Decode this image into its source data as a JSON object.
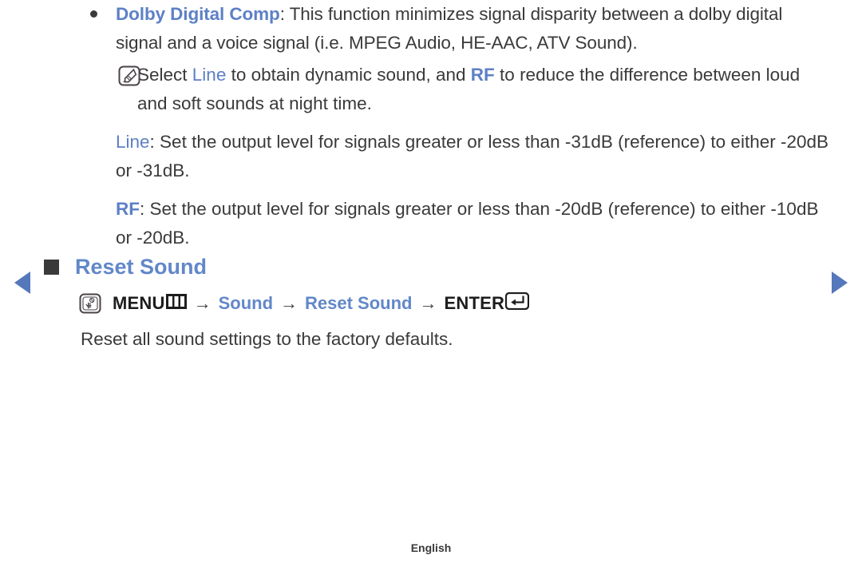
{
  "nav": {
    "prev_icon": "triangle-left-icon",
    "next_icon": "triangle-right-icon",
    "accent_color": "#5577bb"
  },
  "bullet": {
    "term": "Dolby Digital Comp",
    "text_part1": ": This function minimizes signal disparity between a dolby digital signal and a voice signal (i.e. MPEG Audio, HE-AAC, ATV Sound)."
  },
  "note": {
    "icon": "note-pencil-icon",
    "text_before": "Select ",
    "highlight1": "Line",
    "text_middle": " to obtain dynamic sound, and ",
    "highlight2": "RF",
    "text_after": " to reduce the difference between loud and soft sounds at night time."
  },
  "paragraphs": [
    {
      "term": "Line",
      "text": ": Set the output level for signals greater or less than -31dB (reference) to either -20dB or -31dB."
    },
    {
      "term": "RF",
      "text": ": Set the output level for signals greater or less than -20dB (reference) to either -10dB or -20dB."
    }
  ],
  "section": {
    "bullet_icon": "square-bullet-icon",
    "title": "Reset Sound",
    "title_color": "#6287c9",
    "path": {
      "touch_icon": "hand-touch-icon",
      "menu_label": "MENU",
      "menu_glyph_icon": "menu-bars-icon",
      "arrow1": "→",
      "item1": "Sound",
      "arrow2": "→",
      "item2": "Reset Sound",
      "arrow3": "→",
      "enter_label": "ENTER",
      "enter_glyph_icon": "enter-return-icon"
    },
    "description": "Reset all sound settings to the factory defaults."
  },
  "footer": {
    "language": "English"
  }
}
